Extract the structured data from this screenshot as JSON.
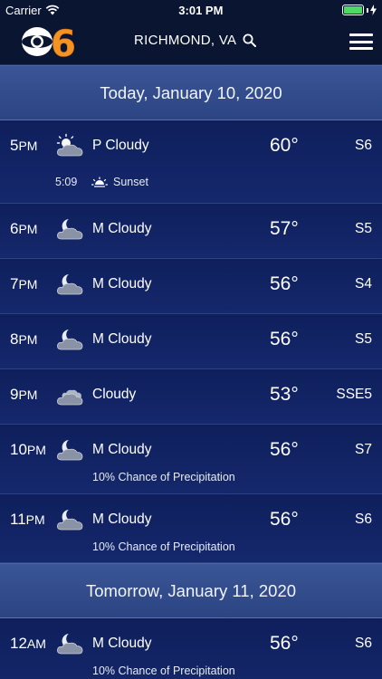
{
  "status_bar": {
    "carrier": "Carrier",
    "time": "3:01 PM",
    "battery_level": 1.0,
    "battery_color": "#4cd964"
  },
  "nav": {
    "logo_text": "6",
    "location": "RICHMOND, VA",
    "search_icon": "search-icon",
    "menu_icon": "hamburger-menu-icon"
  },
  "days": [
    {
      "label": "Today, January 10, 2020",
      "hours": [
        {
          "hour": "5",
          "ampm": "PM",
          "icon": "partly-cloudy-day",
          "condition": "P Cloudy",
          "temp": "60°",
          "wind": "S6",
          "sunset_time": "5:09",
          "sunset_label": "Sunset"
        },
        {
          "hour": "6",
          "ampm": "PM",
          "icon": "mostly-cloudy-night",
          "condition": "M Cloudy",
          "temp": "57°",
          "wind": "S5"
        },
        {
          "hour": "7",
          "ampm": "PM",
          "icon": "mostly-cloudy-night",
          "condition": "M Cloudy",
          "temp": "56°",
          "wind": "S4"
        },
        {
          "hour": "8",
          "ampm": "PM",
          "icon": "mostly-cloudy-night",
          "condition": "M Cloudy",
          "temp": "56°",
          "wind": "S5"
        },
        {
          "hour": "9",
          "ampm": "PM",
          "icon": "cloudy",
          "condition": "Cloudy",
          "temp": "53°",
          "wind": "SSE5"
        },
        {
          "hour": "10",
          "ampm": "PM",
          "icon": "mostly-cloudy-night",
          "condition": "M Cloudy",
          "temp": "56°",
          "wind": "S7",
          "precip": "10% Chance of Precipitation"
        },
        {
          "hour": "11",
          "ampm": "PM",
          "icon": "mostly-cloudy-night",
          "condition": "M Cloudy",
          "temp": "56°",
          "wind": "S6",
          "precip": "10% Chance of Precipitation"
        }
      ]
    },
    {
      "label": "Tomorrow, January 11, 2020",
      "hours": [
        {
          "hour": "12",
          "ampm": "AM",
          "icon": "mostly-cloudy-night",
          "condition": "M Cloudy",
          "temp": "56°",
          "wind": "S6",
          "precip": "10% Chance of Precipitation"
        }
      ]
    }
  ]
}
